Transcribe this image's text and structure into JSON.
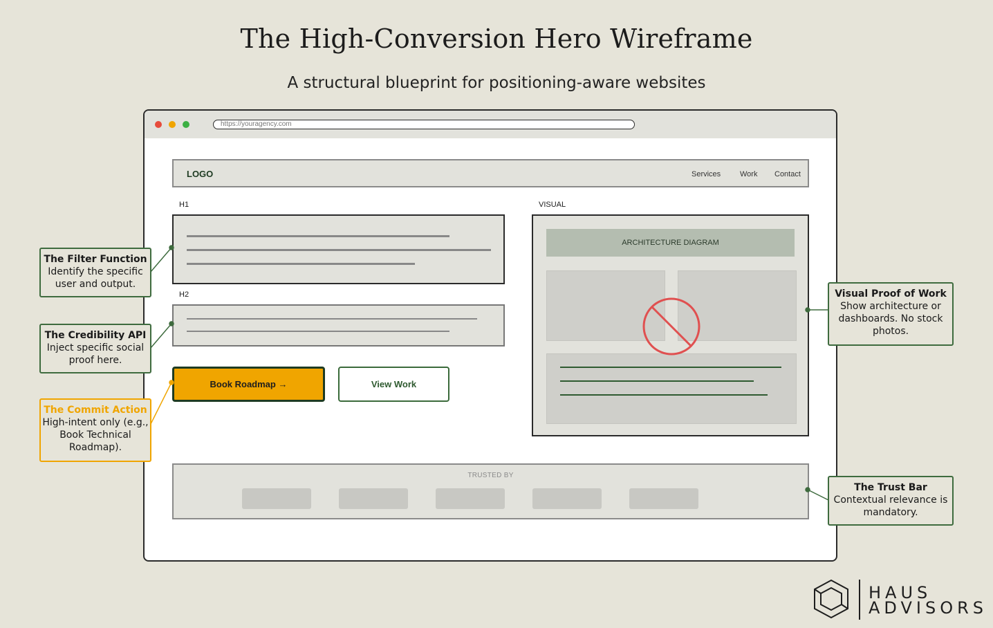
{
  "title": "The High-Conversion Hero Wireframe",
  "subtitle": "A structural blueprint for positioning-aware websites",
  "browser": {
    "url": "https://youragency.com"
  },
  "nav": {
    "logo": "LOGO",
    "links": [
      "Services",
      "Work",
      "Contact"
    ]
  },
  "hero": {
    "h1_label": "H1",
    "h2_label": "H2",
    "primary_button": "Book Roadmap →",
    "secondary_button": "View Work"
  },
  "visual": {
    "label": "VISUAL",
    "diagram_label": "ARCHITECTURE DIAGRAM"
  },
  "trust_bar": {
    "label": "TRUSTED BY"
  },
  "callouts": {
    "filter": {
      "title": "The Filter Function",
      "body": "Identify the specific user and output."
    },
    "credibility": {
      "title": "The Credibility API",
      "body": "Inject specific social proof here."
    },
    "commit": {
      "title": "The Commit Action",
      "body": "High-intent only (e.g., Book Technical Roadmap)."
    },
    "visual_proof": {
      "title": "Visual Proof of Work",
      "body": "Show architecture or dashboards. No stock photos."
    },
    "trust": {
      "title": "The Trust Bar",
      "body": "Contextual relevance is mandatory."
    }
  },
  "brand": {
    "line1": "HAUS",
    "line2": "ADVISORS"
  },
  "colors": {
    "background": "#e6e4d9",
    "accent_orange": "#f0a500",
    "accent_green": "#3e6b3e",
    "no_symbol_red": "#e05050"
  }
}
